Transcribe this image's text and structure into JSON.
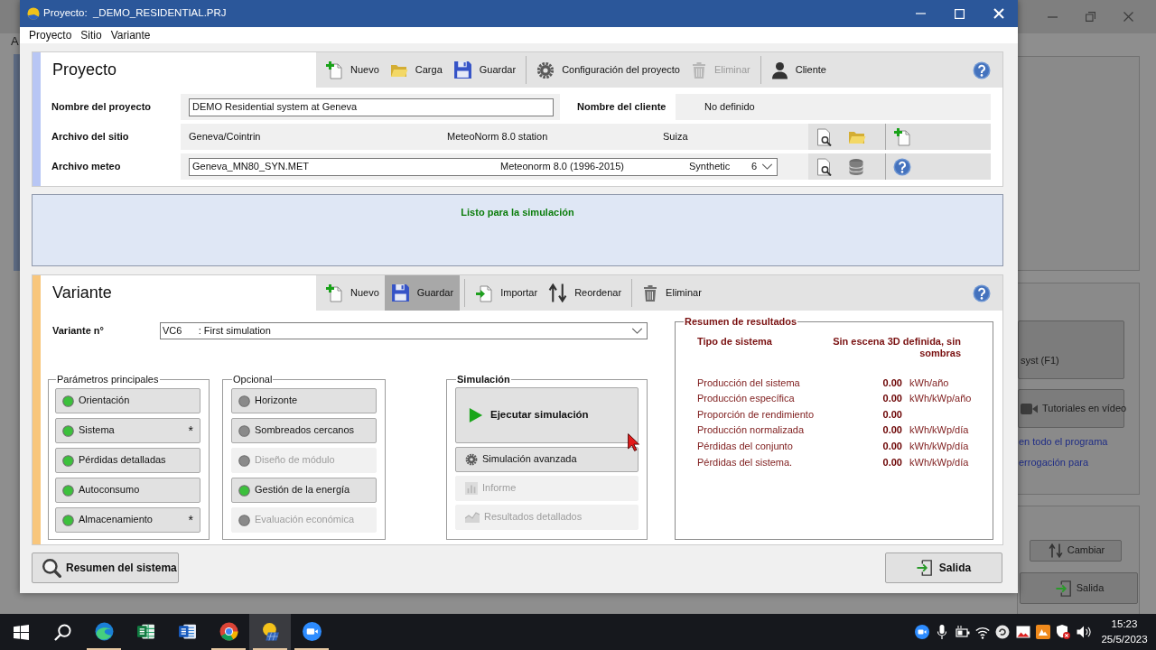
{
  "background_window": {
    "menu": [
      "A"
    ],
    "buttons": [
      {
        "label": "syst (F1)",
        "kind": "plain"
      },
      {
        "label": "Tutoriales en vídeo",
        "kind": "video"
      }
    ],
    "links": [
      "en todo el programa",
      "errogación para"
    ],
    "bottom_buttons": [
      {
        "label": "Cambiar",
        "kind": "reorder"
      },
      {
        "label": "Salida",
        "kind": "exit"
      }
    ]
  },
  "window": {
    "title": "Proyecto:  _DEMO_RESIDENTIAL.PRJ"
  },
  "menu": [
    "Proyecto",
    "Sitio",
    "Variante"
  ],
  "project": {
    "title": "Proyecto",
    "toolbar": [
      [
        {
          "label": "Nuevo",
          "kind": "new",
          "disabled": false
        },
        {
          "label": "Carga",
          "kind": "open",
          "disabled": false
        },
        {
          "label": "Guardar",
          "kind": "save",
          "disabled": false
        }
      ],
      [
        {
          "label": "Configuración del proyecto",
          "kind": "settings",
          "disabled": false
        },
        {
          "label": "Eliminar",
          "kind": "delete",
          "disabled": true
        }
      ],
      [
        {
          "label": "Cliente",
          "kind": "client",
          "disabled": false
        }
      ]
    ],
    "project_name": {
      "label": "Nombre del proyecto",
      "value": "DEMO Residential system at Geneva"
    },
    "client": {
      "label": "Nombre del cliente",
      "value": "No definido"
    },
    "site_file": {
      "label": "Archivo del sitio",
      "site": "Geneva/Cointrin",
      "source": "MeteoNorm 8.0 station",
      "country": "Suiza"
    },
    "meteo_file": {
      "label": "Archivo meteo",
      "file": "Geneva_MN80_SYN.MET",
      "source": "Meteonorm 8.0 (1996-2015)",
      "type": "Synthetic",
      "column_4": "6"
    }
  },
  "status": {
    "message": "Listo para la simulación"
  },
  "variant": {
    "title": "Variante",
    "toolbar": [
      [
        {
          "label": "Nuevo",
          "kind": "new",
          "pressed": false
        },
        {
          "label": "Guardar",
          "kind": "save",
          "pressed": true
        }
      ],
      [
        {
          "label": "Importar",
          "kind": "import",
          "pressed": false
        },
        {
          "label": "Reordenar",
          "kind": "reorder",
          "pressed": false
        }
      ],
      [
        {
          "label": "Eliminar",
          "kind": "delete",
          "pressed": false
        }
      ]
    ],
    "number": {
      "label": "Variante n°",
      "value": "VC6      : First simulation"
    },
    "groups": [
      {
        "title": "Parámetros principales",
        "items": [
          {
            "label": "Orientación",
            "color": "#3cc03c",
            "disabled": false
          },
          {
            "label": "Sistema",
            "color": "#3cc03c",
            "disabled": false,
            "note": "*"
          },
          {
            "label": "Pérdidas detalladas",
            "color": "#3cc03c",
            "disabled": false
          },
          {
            "label": "Autoconsumo",
            "color": "#3cc03c",
            "disabled": false
          },
          {
            "label": "Almacenamiento",
            "color": "#3cc03c",
            "disabled": false,
            "note": "*"
          }
        ]
      },
      {
        "title": "Opcional",
        "items": [
          {
            "label": "Horizonte",
            "color": "#8a8a8a",
            "disabled": false
          },
          {
            "label": "Sombreados cercanos",
            "color": "#8a8a8a",
            "disabled": false
          },
          {
            "label": "Diseño de módulo",
            "color": "#8a8a8a",
            "disabled": true
          },
          {
            "label": "Gestión de la energía",
            "color": "#3cc03c",
            "disabled": false
          },
          {
            "label": "Evaluación económica",
            "color": "#8a8a8a",
            "disabled": true
          }
        ]
      }
    ],
    "simulation": {
      "title": "Simulación",
      "buttons": [
        {
          "label": "Ejecutar simulación",
          "kind": "run",
          "disabled": false
        },
        {
          "label": "Simulación avanzada",
          "kind": "advanced",
          "disabled": false
        },
        {
          "label": "Informe",
          "kind": "report",
          "disabled": true
        },
        {
          "label": "Resultados detallados",
          "kind": "details",
          "disabled": true
        }
      ]
    },
    "results": {
      "title": "Resumen de resultados",
      "system_type_label": "Tipo de sistema",
      "system_type": "Sin escena 3D definida, sin sombras",
      "rows": [
        {
          "label": "Producción del sistema",
          "value": "0.00",
          "unit": "kWh/año"
        },
        {
          "label": "Producción específica",
          "value": "0.00",
          "unit": "kWh/kWp/año"
        },
        {
          "label": "Proporción de rendimiento",
          "value": "0.00"
        },
        {
          "label": "Producción normalizada",
          "value": "0.00",
          "unit": "kWh/kWp/día"
        },
        {
          "label": "Pérdidas del conjunto",
          "value": "0.00",
          "unit": "kWh/kWp/día"
        },
        {
          "label": "Pérdidas del sistema.",
          "value": "0.00",
          "unit": "kWh/kWp/día"
        }
      ]
    }
  },
  "footer": [
    {
      "label": "Resumen del sistema",
      "kind": "summary"
    },
    {
      "label": "Salida",
      "kind": "exit"
    }
  ],
  "taskbar": {
    "apps": [
      {
        "kind": "browser",
        "running": true,
        "selected": false
      },
      {
        "kind": "spreadsheet",
        "running": false,
        "selected": false
      },
      {
        "kind": "document",
        "running": false,
        "selected": false
      },
      {
        "kind": "round",
        "running": true,
        "selected": false
      },
      {
        "kind": "solar",
        "running": true,
        "selected": true
      },
      {
        "kind": "video",
        "running": true,
        "selected": false
      }
    ],
    "time": "15:23",
    "date": "25/5/2023"
  }
}
